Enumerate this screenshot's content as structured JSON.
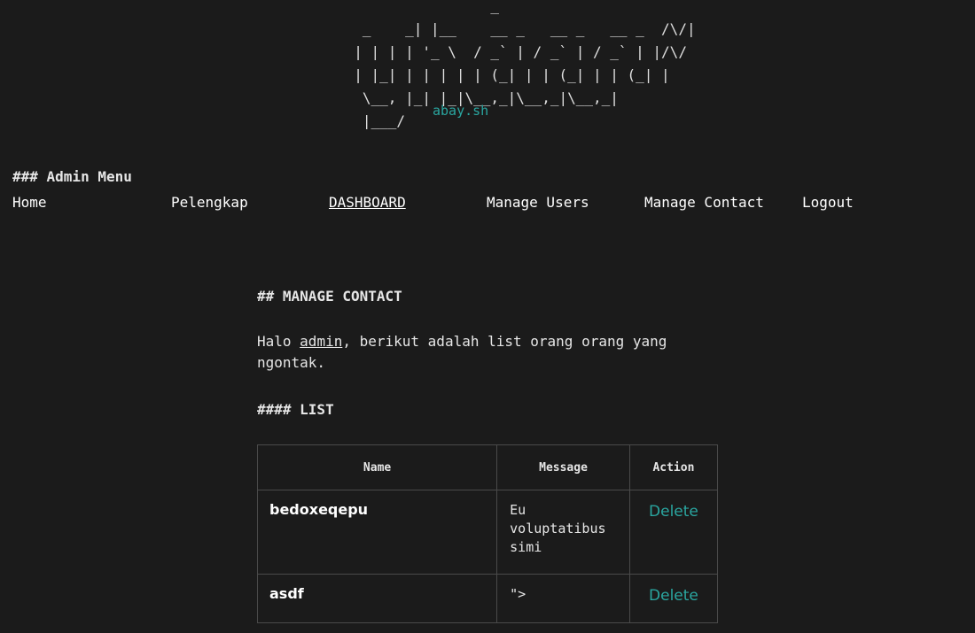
{
  "header": {
    "logo_ascii": "                  _\n   _    _| |__    __ _   __ _   __ _  /\\/|\n  | | | | '_ \\  / _` | / _` | / _` | |/\\/\n  | |_| | | | | | (_| | | (_| | | (_| |\n   \\__, |_| |_|\\__,_|\\__,_|\\__,_|\n   |___/",
    "site_name": "abay.sh"
  },
  "admin_menu": {
    "heading": "### Admin Menu",
    "items": [
      {
        "label": "Home"
      },
      {
        "label": "Pelengkap"
      },
      {
        "label": "DASHBOARD",
        "active": true
      },
      {
        "label": "Manage Users"
      },
      {
        "label": "Manage Contact"
      },
      {
        "label": "Logout"
      }
    ]
  },
  "main": {
    "title": "## MANAGE CONTACT",
    "greeting_prefix": "Halo ",
    "username": "admin",
    "greeting_suffix": ", berikut adalah list orang orang yang ngontak.",
    "list_title": "#### LIST",
    "table": {
      "columns": [
        "Name",
        "Message",
        "Action"
      ],
      "rows": [
        {
          "name": "bedoxeqepu",
          "message": "Eu voluptatibus simi",
          "action": "Delete"
        },
        {
          "name": "asdf",
          "message": "\">",
          "action": "Delete"
        }
      ]
    }
  },
  "colors": {
    "background": "#1b1b1b",
    "text": "#e6e6e6",
    "accent": "#2aa6a0",
    "border": "#4a4a4a"
  }
}
